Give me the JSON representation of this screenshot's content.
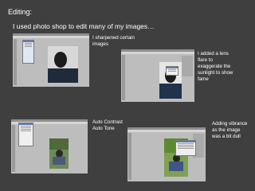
{
  "heading": "Editing:",
  "intro": "I used photo shop to edit many of my images…",
  "captions": {
    "sharpen": [
      "I sharpened certain",
      "images"
    ],
    "lens_flare": [
      "I added a lens",
      "flare to",
      "exaggerate the",
      "sunlight to show",
      "fame"
    ],
    "auto": [
      "Auto Contrast",
      "Auto Tone"
    ],
    "vibrance": [
      "Adding vibrance",
      "as the image",
      "was a bit dull"
    ]
  },
  "colors": {
    "background": "#3f3f3f",
    "text": "#ffffff",
    "app_canvas": "#bdbdbd"
  }
}
